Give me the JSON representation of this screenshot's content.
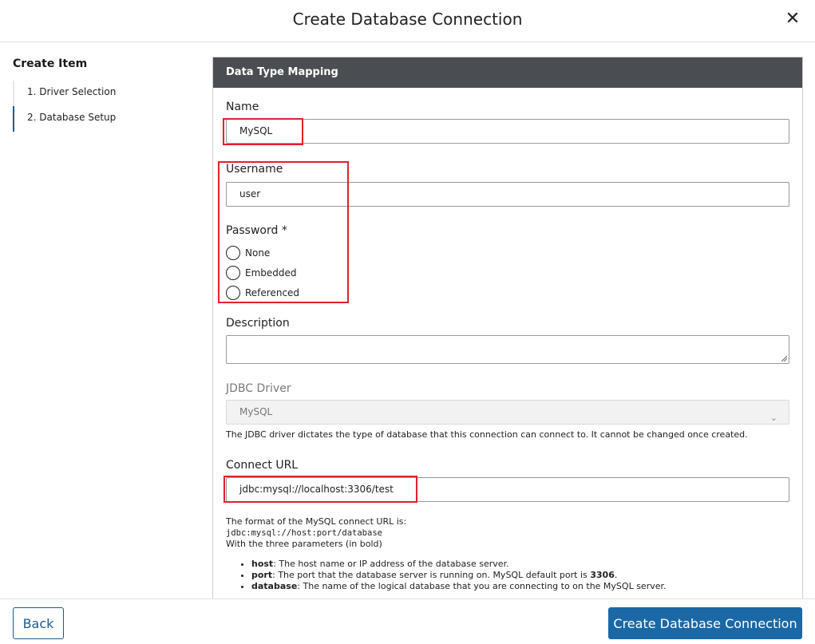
{
  "dialog": {
    "title": "Create Database Connection"
  },
  "sidebar": {
    "heading": "Create Item",
    "steps": [
      {
        "label": "1. Driver Selection",
        "active": false
      },
      {
        "label": "2. Database Setup",
        "active": true
      }
    ]
  },
  "panel": {
    "title": "Data Type Mapping"
  },
  "form": {
    "name": {
      "label": "Name",
      "value": "MySQL"
    },
    "username": {
      "label": "Username",
      "value": "user"
    },
    "password": {
      "label": "Password *",
      "options": [
        "None",
        "Embedded",
        "Referenced"
      ],
      "selected": null
    },
    "description": {
      "label": "Description",
      "value": ""
    },
    "jdbc_driver": {
      "label": "JDBC Driver",
      "value": "MySQL",
      "help": "The JDBC driver dictates the type of database that this connection can connect to. It cannot be changed once created."
    },
    "connect_url": {
      "label": "Connect URL",
      "value": "jdbc:mysql://localhost:3306/test",
      "help_intro": "The format of the MySQL connect URL is:",
      "help_format": "jdbc:mysql://host:port/database",
      "help_params": "With the three parameters (in bold)",
      "bullets": [
        {
          "term": "host",
          "text": ": The host name or IP address of the database server."
        },
        {
          "term": "port",
          "text": ": The port that the database server is running on. MySQL default port is ",
          "bold_tail": "3306",
          "tail": "."
        },
        {
          "term": "database",
          "text": ": The name of the logical database that you are connecting to on the MySQL server."
        }
      ]
    }
  },
  "footer": {
    "back_label": "Back",
    "create_label": "Create Database Connection"
  },
  "icons": {
    "close": "close-icon",
    "chevron": "chevron-down-icon"
  },
  "colors": {
    "primary": "#1b68a6",
    "panel_header": "#4a4d51",
    "highlight": "#e0212b"
  }
}
